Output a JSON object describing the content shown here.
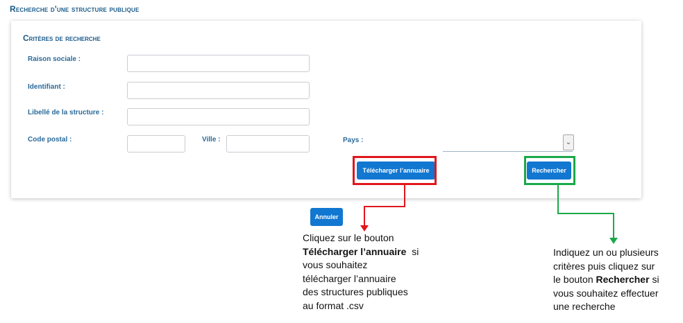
{
  "page": {
    "title": "Recherche d'une structure publique"
  },
  "panel": {
    "section_title": "Critères de recherche",
    "labels": {
      "raison_sociale": "Raison sociale :",
      "identifiant": "Identifiant :",
      "libelle": "Libellé de la structure :",
      "code_postal": "Code postal :",
      "ville": "Ville :",
      "pays": "Pays :"
    },
    "buttons": {
      "telecharger": "Télécharger l’annuaire",
      "rechercher": "Rechercher"
    }
  },
  "annuler_label": "Annuler",
  "annotations": {
    "left": {
      "line1": "Cliquez sur le bouton",
      "bold": "Télécharger l’annuaire",
      "after_bold": "si",
      "line3": "vous souhaitez",
      "line4": "télécharger l’annuaire",
      "line5": "des structures publiques",
      "line6": "au format .csv"
    },
    "right": {
      "line1": "Indiquez un ou plusieurs",
      "line2": "critères puis cliquez sur",
      "line3_prefix": "le bouton",
      "bold": "Rechercher",
      "line3_suffix": "si",
      "line4": "vous souhaitez effectuer",
      "line5": "une recherche"
    }
  },
  "colors": {
    "highlight_red": "#e0161b",
    "highlight_green": "#1aa84a",
    "button_blue": "#1177d1",
    "title_blue": "#1a5a8a"
  }
}
